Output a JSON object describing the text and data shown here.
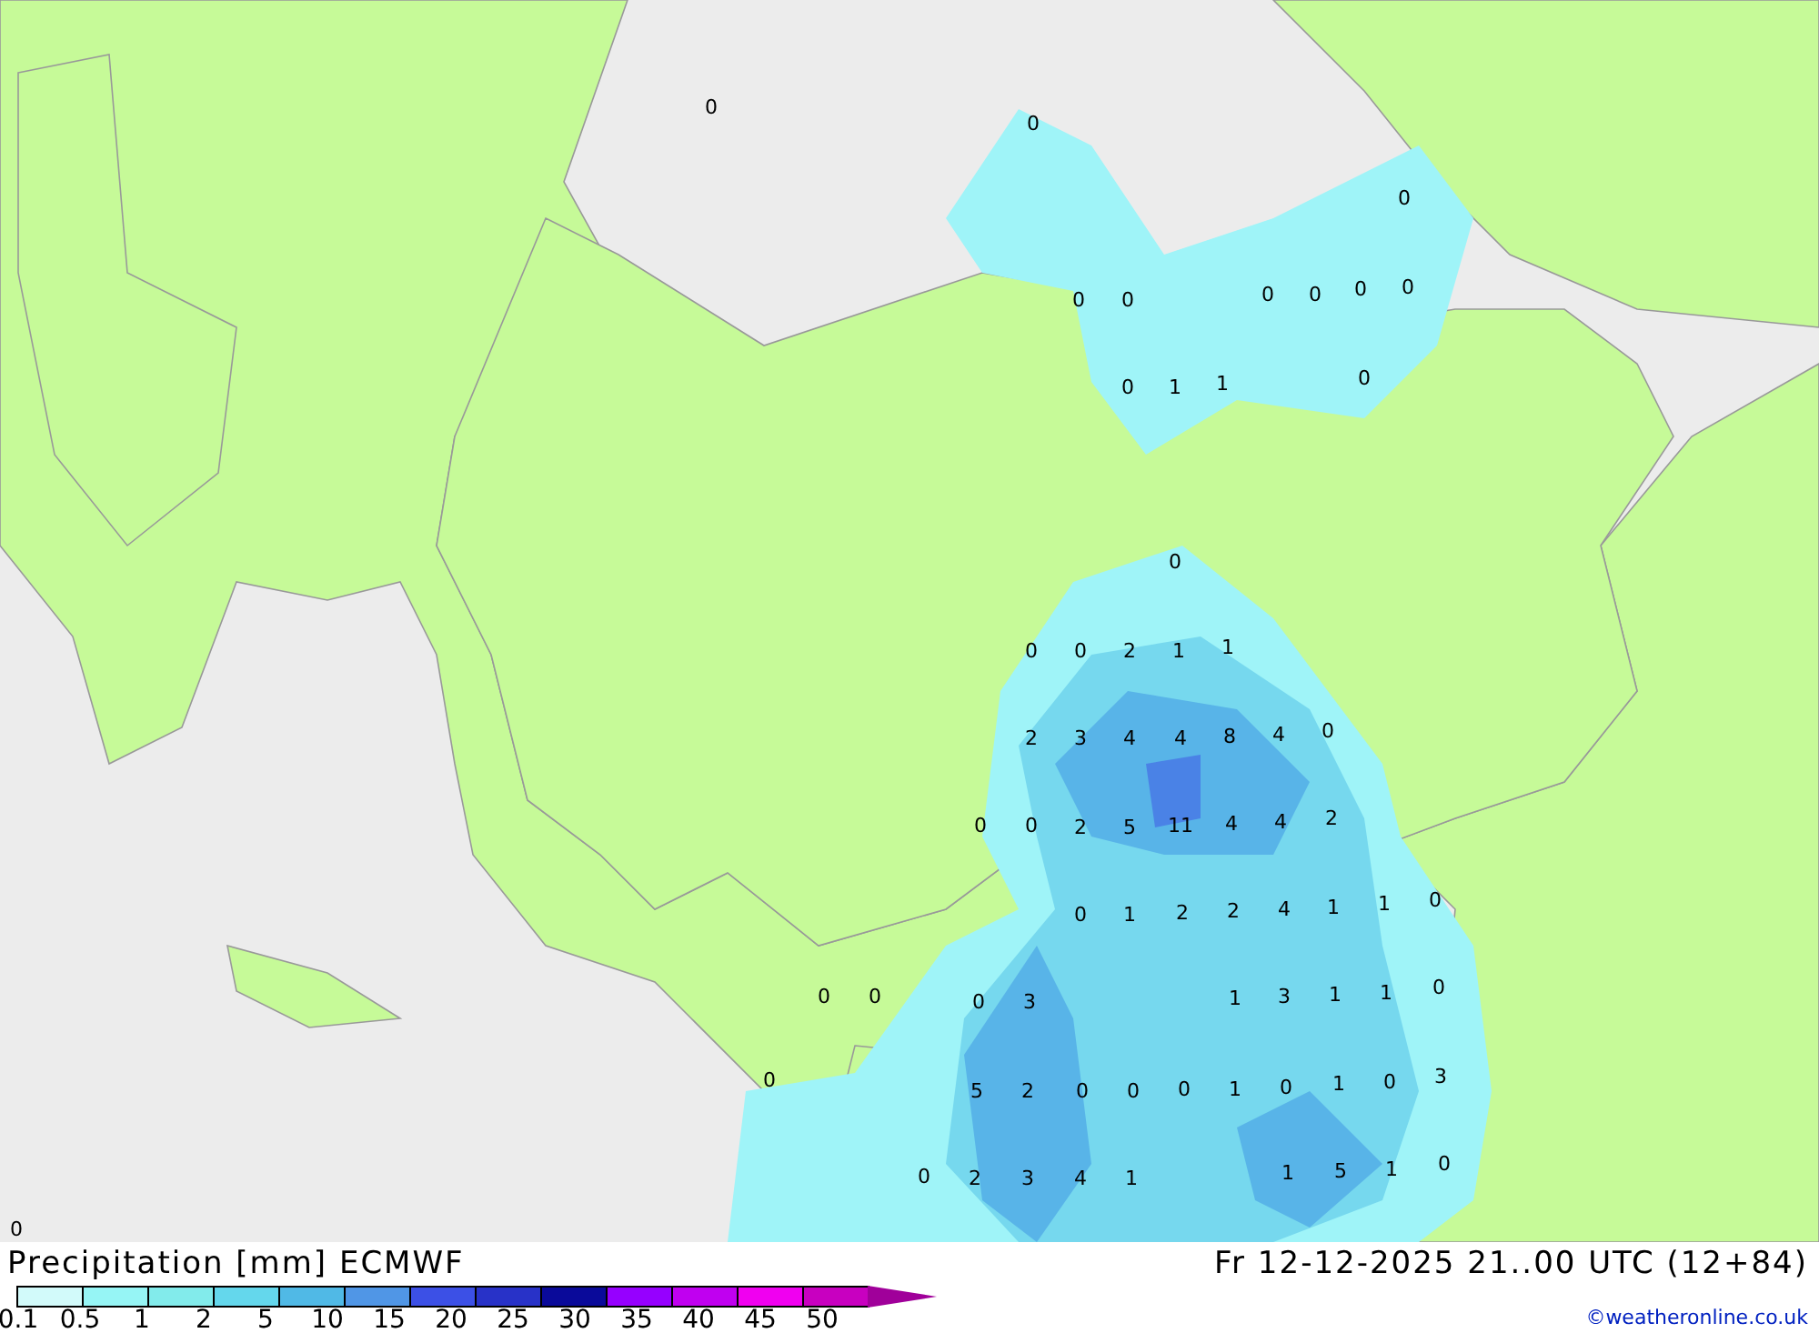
{
  "map": {
    "labels": [
      {
        "text": "0"
      },
      {
        "text": "0"
      },
      {
        "text": "0"
      },
      {
        "text": "0"
      },
      {
        "text": "0"
      },
      {
        "text": "0"
      },
      {
        "text": "0"
      },
      {
        "text": "0"
      },
      {
        "text": "0"
      },
      {
        "text": "0"
      },
      {
        "text": "1"
      },
      {
        "text": "1"
      },
      {
        "text": "0"
      },
      {
        "text": "0"
      },
      {
        "text": "0"
      },
      {
        "text": "0"
      },
      {
        "text": "2"
      },
      {
        "text": "1"
      },
      {
        "text": "1"
      },
      {
        "text": "2"
      },
      {
        "text": "3"
      },
      {
        "text": "4"
      },
      {
        "text": "4"
      },
      {
        "text": "8"
      },
      {
        "text": "4"
      },
      {
        "text": "0"
      },
      {
        "text": "0"
      },
      {
        "text": "0"
      },
      {
        "text": "2"
      },
      {
        "text": "5"
      },
      {
        "text": "11"
      },
      {
        "text": "4"
      },
      {
        "text": "4"
      },
      {
        "text": "2"
      },
      {
        "text": "0"
      },
      {
        "text": "1"
      },
      {
        "text": "2"
      },
      {
        "text": "2"
      },
      {
        "text": "4"
      },
      {
        "text": "1"
      },
      {
        "text": "1"
      },
      {
        "text": "0"
      },
      {
        "text": "0"
      },
      {
        "text": "0"
      },
      {
        "text": "0"
      },
      {
        "text": "3"
      },
      {
        "text": "1"
      },
      {
        "text": "3"
      },
      {
        "text": "1"
      },
      {
        "text": "1"
      },
      {
        "text": "0"
      },
      {
        "text": "0"
      },
      {
        "text": "5"
      },
      {
        "text": "2"
      },
      {
        "text": "0"
      },
      {
        "text": "0"
      },
      {
        "text": "0"
      },
      {
        "text": "1"
      },
      {
        "text": "0"
      },
      {
        "text": "1"
      },
      {
        "text": "0"
      },
      {
        "text": "3"
      },
      {
        "text": "0"
      },
      {
        "text": "2"
      },
      {
        "text": "3"
      },
      {
        "text": "4"
      },
      {
        "text": "1"
      },
      {
        "text": "1"
      },
      {
        "text": "5"
      },
      {
        "text": "1"
      },
      {
        "text": "0"
      },
      {
        "text": "0"
      }
    ]
  },
  "footer": {
    "title": "Precipitation [mm] ECMWF",
    "valid_time": "Fr 12-12-2025 21..00 UTC (12+84)",
    "credit": "©weatheronline.co.uk",
    "legend": {
      "segments": [
        {
          "color": "#d2fafa"
        },
        {
          "color": "#96f5f5"
        },
        {
          "color": "#82ebeb"
        },
        {
          "color": "#64d7ec"
        },
        {
          "color": "#50b9e6"
        },
        {
          "color": "#5096e6"
        },
        {
          "color": "#3c50e6"
        },
        {
          "color": "#2832c8"
        },
        {
          "color": "#0a0a9a"
        },
        {
          "color": "#9600ff"
        },
        {
          "color": "#c000f0"
        },
        {
          "color": "#f000f0"
        },
        {
          "color": "#c800c0"
        }
      ],
      "arrow": {
        "color": "#a0009a"
      },
      "ticks": [
        "0.1",
        "0.5",
        "1",
        "2",
        "5",
        "10",
        "15",
        "20",
        "25",
        "30",
        "35",
        "40",
        "45",
        "50"
      ]
    }
  }
}
